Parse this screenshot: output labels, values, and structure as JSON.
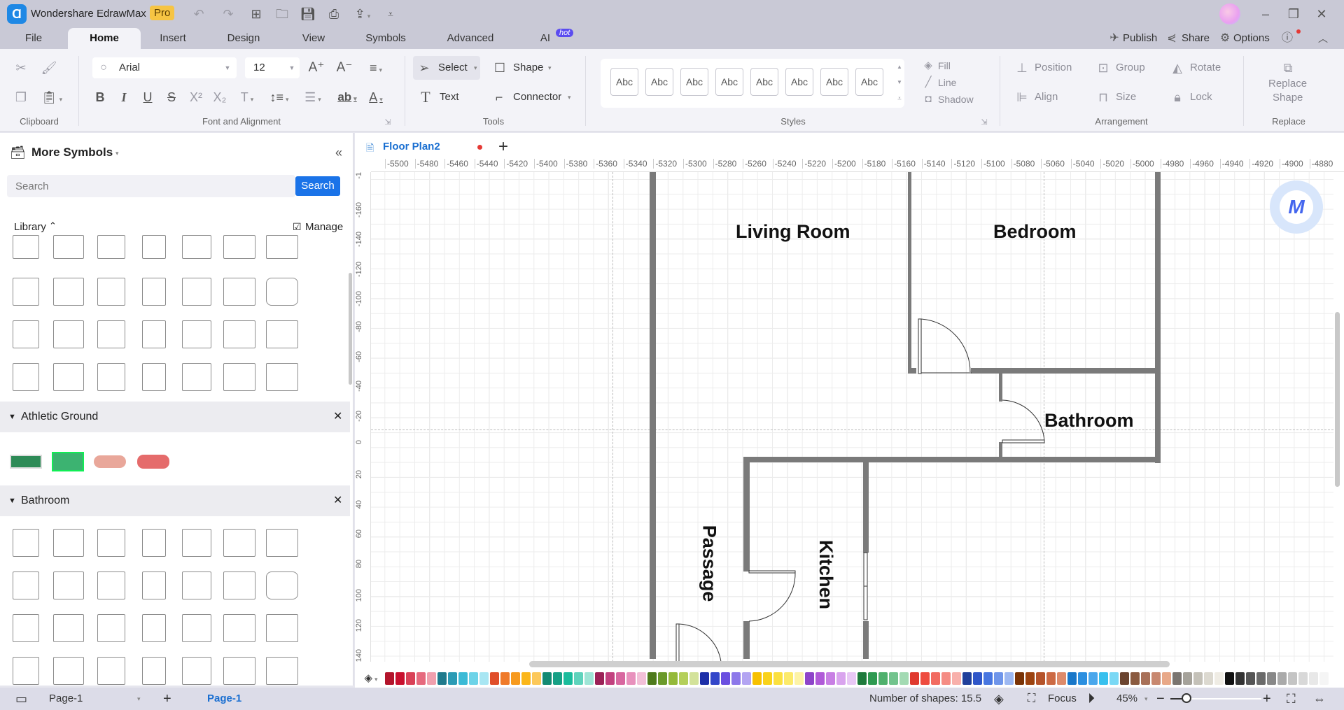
{
  "app": {
    "title": "Wondershare EdrawMax",
    "badge": "Pro"
  },
  "window_controls": [
    "minimize",
    "restore",
    "close"
  ],
  "menu_tabs": [
    {
      "label": "File"
    },
    {
      "label": "Home",
      "active": true
    },
    {
      "label": "Insert"
    },
    {
      "label": "Design"
    },
    {
      "label": "View"
    },
    {
      "label": "Symbols"
    },
    {
      "label": "Advanced"
    },
    {
      "label": "AI",
      "badge": "hot"
    }
  ],
  "header_actions": {
    "publish": "Publish",
    "share": "Share",
    "options": "Options"
  },
  "ribbon": {
    "clipboard_label": "Clipboard",
    "font_label": "Font and Alignment",
    "font_family": "Arial",
    "font_size": "12",
    "tools_label": "Tools",
    "select": "Select",
    "shape": "Shape",
    "text": "Text",
    "connector": "Connector",
    "styles_label": "Styles",
    "style_swatches": [
      "Abc",
      "Abc",
      "Abc",
      "Abc",
      "Abc",
      "Abc",
      "Abc",
      "Abc"
    ],
    "fill": "Fill",
    "line": "Line",
    "shadow": "Shadow",
    "arrangement_label": "Arrangement",
    "position": "Position",
    "group": "Group",
    "rotate": "Rotate",
    "align": "Align",
    "size": "Size",
    "lock": "Lock",
    "replace_shape_line1": "Replace",
    "replace_shape_line2": "Shape",
    "replace_label": "Replace"
  },
  "left_panel": {
    "title": "More Symbols",
    "search_placeholder": "Search",
    "search_button": "Search",
    "library_label": "Library",
    "manage_label": "Manage",
    "sections": [
      {
        "name": "Athletic Ground"
      },
      {
        "name": "Bathroom"
      }
    ]
  },
  "document": {
    "tab_name": "Floor Plan2",
    "unsaved": true
  },
  "ruler": {
    "x_ticks": [
      "-5500",
      "-5480",
      "-5460",
      "-5440",
      "-5420",
      "-5400",
      "-5380",
      "-5360",
      "-5340",
      "-5320",
      "-5300",
      "-5280",
      "-5260",
      "-5240",
      "-5220",
      "-5200",
      "-5180",
      "-5160",
      "-5140",
      "-5120",
      "-5100",
      "-5080",
      "-5060",
      "-5040",
      "-5020",
      "-5000",
      "-4980",
      "-4960",
      "-4940",
      "-4920",
      "-4900",
      "-4880"
    ],
    "y_ticks": [
      "-1",
      "-160",
      "-140",
      "-120",
      "-100",
      "-80",
      "-60",
      "-40",
      "-20",
      "0",
      "20",
      "40",
      "60",
      "80",
      "100",
      "120",
      "140"
    ]
  },
  "floor_plan": {
    "rooms": [
      {
        "name": "Living Room"
      },
      {
        "name": "Bedroom"
      },
      {
        "name": "Bathroom"
      },
      {
        "name": "Passage"
      },
      {
        "name": "Kitchen"
      }
    ]
  },
  "palette": {
    "colors": [
      "#b3142b",
      "#c8102e",
      "#d94157",
      "#e66a7e",
      "#f0a0ae",
      "#1f7a8c",
      "#2b9bb5",
      "#3bbad6",
      "#6dd3e8",
      "#a8e6f3",
      "#e04e2a",
      "#ef7a2a",
      "#f79a1e",
      "#fbb61a",
      "#fcc85a",
      "#138a72",
      "#16a085",
      "#1abc9c",
      "#5fd3bc",
      "#9fe5d6",
      "#9b2257",
      "#c2417f",
      "#d867a0",
      "#e891bd",
      "#f2c0d8",
      "#4e7a1c",
      "#6b9a2b",
      "#94b93a",
      "#b4cf5a",
      "#d3e29a",
      "#1d2fa8",
      "#3346c9",
      "#6a4fe0",
      "#8d78ea",
      "#b3a4f2",
      "#f7c000",
      "#f9d21a",
      "#fbe03f",
      "#fcea6a",
      "#fdf3a6",
      "#8e44c9",
      "#b05ad8",
      "#c87fe4",
      "#d9a4ee",
      "#e8c8f5",
      "#1e7a3c",
      "#2e9a51",
      "#4fb06d",
      "#72c38d",
      "#a3dab3",
      "#e03a2f",
      "#ee4c40",
      "#f26b61",
      "#f58c84",
      "#f8b0ab",
      "#203f9a",
      "#2f56c8",
      "#4876e0",
      "#6f95ea",
      "#9db8f2",
      "#7a3306",
      "#9c4310",
      "#b5532a",
      "#cc6a44",
      "#dd8a6a",
      "#1877c9",
      "#2b8fe0",
      "#4aa7ec",
      "#38c0ee",
      "#7ad8f5",
      "#6b4430",
      "#8a5a40",
      "#a87058",
      "#c88870",
      "#e8a888",
      "#7a7570",
      "#a5a29a",
      "#c4c1b8",
      "#dcd9d0",
      "#efece4",
      "#111111",
      "#333333",
      "#555555",
      "#6a6a6a",
      "#888888",
      "#aaaaaa",
      "#c4c4c4",
      "#d8d8d8",
      "#e8e8e8",
      "#f5f5f5"
    ]
  },
  "status_bar": {
    "page_selector": "Page-1",
    "active_page_tab": "Page-1",
    "shapes_count": "Number of shapes: 15.5",
    "focus": "Focus",
    "zoom": "45%",
    "zoom_percent": 45
  }
}
